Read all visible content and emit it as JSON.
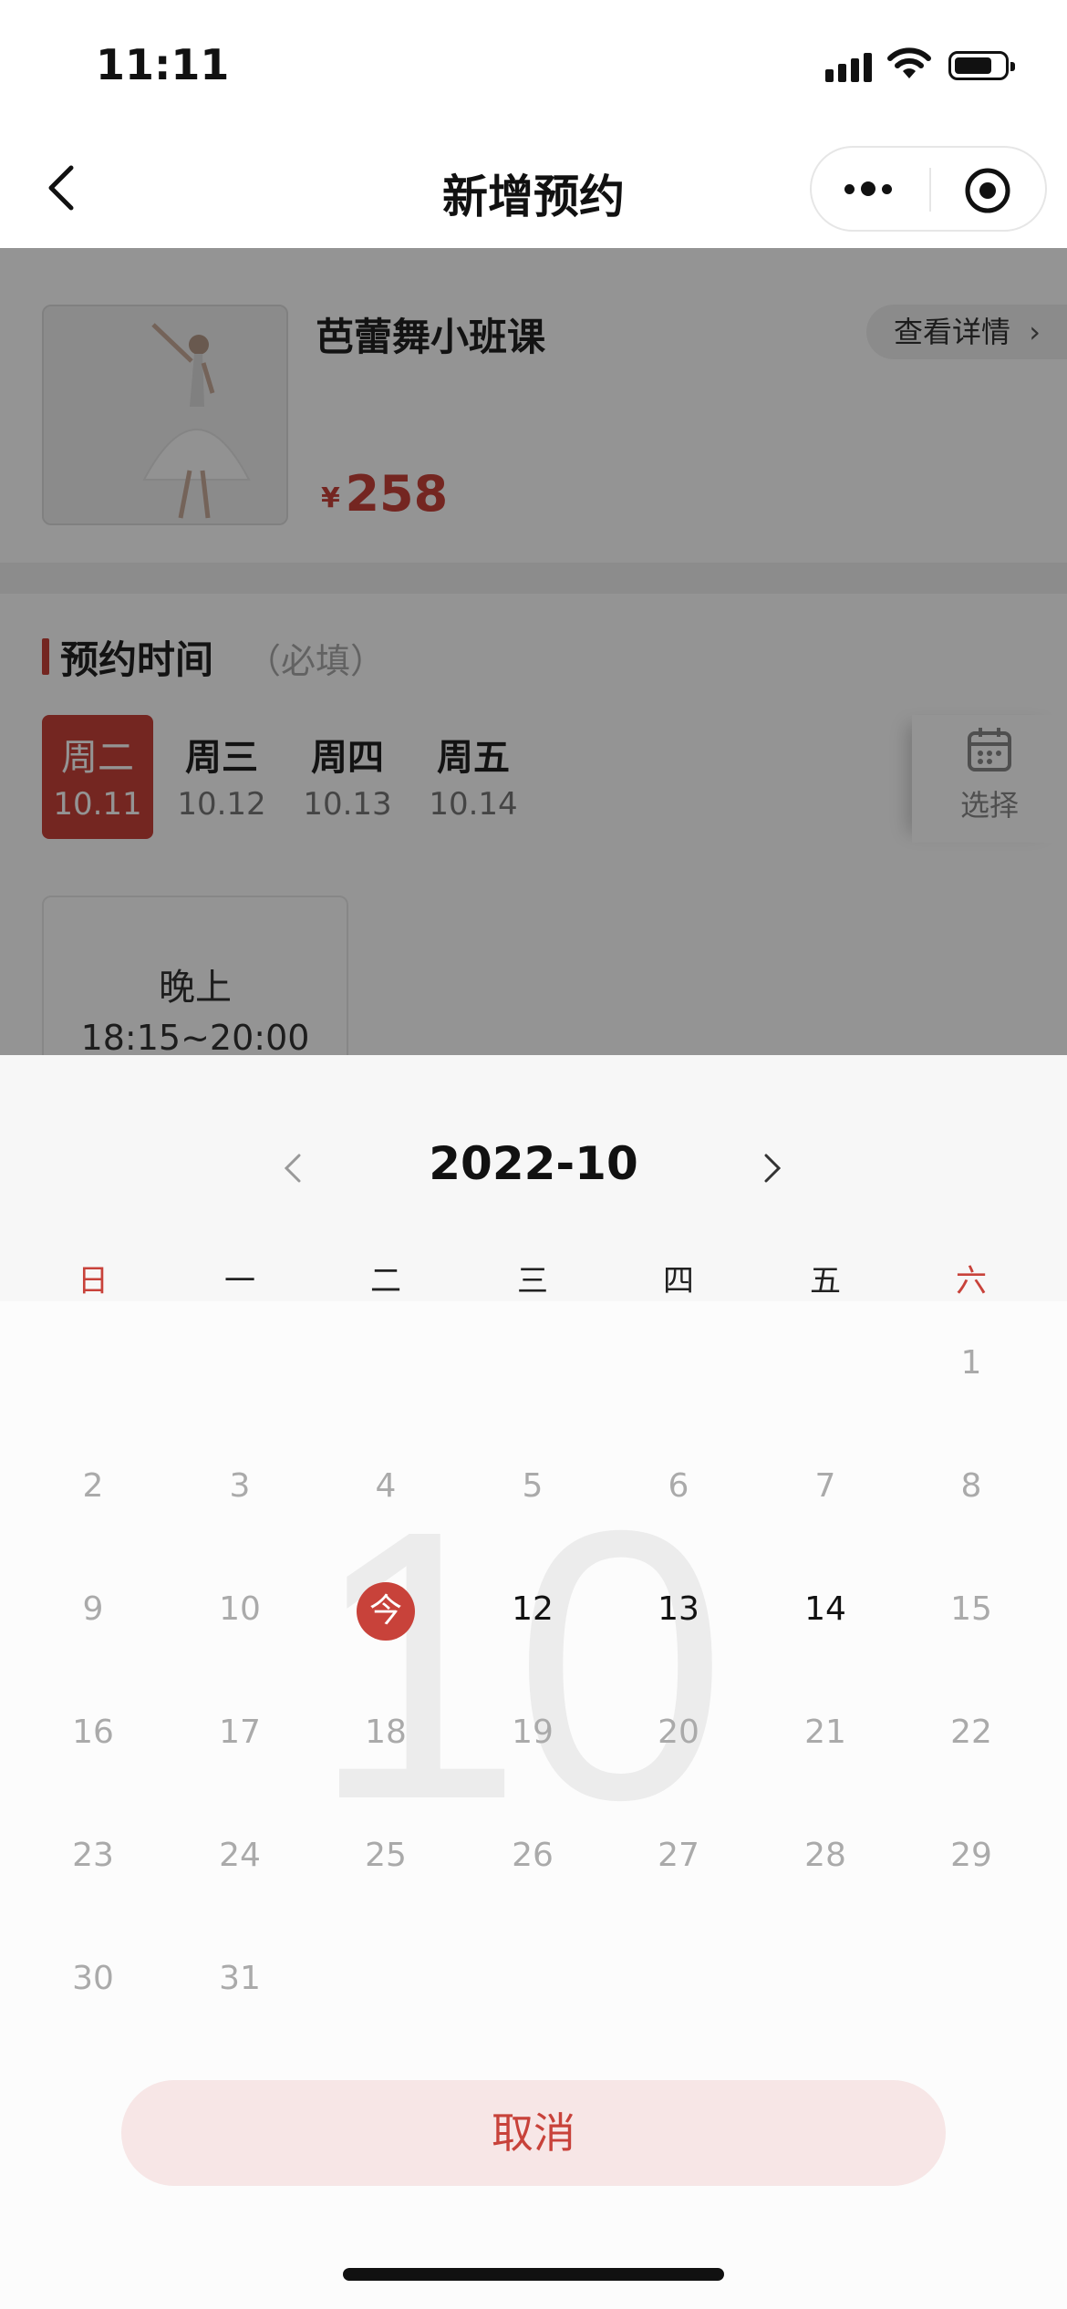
{
  "status_bar": {
    "time": "11:11"
  },
  "navbar": {
    "title": "新增预约"
  },
  "course": {
    "title": "芭蕾舞小班课",
    "detail_label": "查看详情",
    "price_symbol": "¥",
    "price": "258"
  },
  "booking": {
    "section_title": "预约时间",
    "section_hint": "（必填）",
    "days": [
      {
        "weekday": "周二",
        "date": "10.11",
        "selected": true
      },
      {
        "weekday": "周三",
        "date": "10.12",
        "selected": false
      },
      {
        "weekday": "周四",
        "date": "10.13",
        "selected": false
      },
      {
        "weekday": "周五",
        "date": "10.14",
        "selected": false
      }
    ],
    "select_label": "选择",
    "slot": {
      "name": "晚上",
      "time": "18:15~20:00"
    }
  },
  "calendar": {
    "month_label": "2022-10",
    "watermark": "10",
    "weekdays": [
      "日",
      "一",
      "二",
      "三",
      "四",
      "五",
      "六"
    ],
    "today_label": "今",
    "cells": [
      [
        "",
        "",
        "",
        "",
        "",
        "",
        "1"
      ],
      [
        "2",
        "3",
        "4",
        "5",
        "6",
        "7",
        "8"
      ],
      [
        "9",
        "10",
        "今",
        "12",
        "13",
        "14",
        "15"
      ],
      [
        "16",
        "17",
        "18",
        "19",
        "20",
        "21",
        "22"
      ],
      [
        "23",
        "24",
        "25",
        "26",
        "27",
        "28",
        "29"
      ],
      [
        "30",
        "31",
        "",
        "",
        "",
        "",
        ""
      ]
    ],
    "active_days": [
      "12",
      "13",
      "14"
    ],
    "cancel_label": "取消"
  },
  "colors": {
    "accent": "#c8423a",
    "cancel_bg": "#f7e6e6"
  }
}
